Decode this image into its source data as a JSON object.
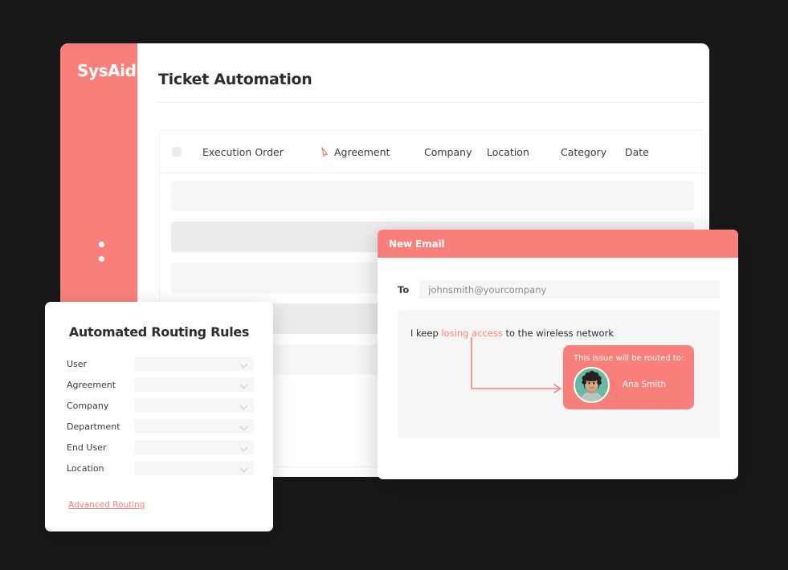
{
  "theme": {
    "accent": "#f9807a",
    "page_background": "#181818",
    "card_background": "#ffffff",
    "row_light": "#f7f7f8",
    "row_dark": "#edebed",
    "field_background": "#f6f6f7",
    "avatar_background": "#6bb9a4"
  },
  "sidebar": {
    "logo": "SysAid.",
    "nav_dots": 2
  },
  "main": {
    "page_title": "Ticket Automation"
  },
  "table": {
    "columns": [
      {
        "key": "select",
        "label": "",
        "icon": "checkbox-icon"
      },
      {
        "key": "execution_order",
        "label": "Execution Order",
        "icon": ""
      },
      {
        "key": "cursor",
        "label": "",
        "icon": "cursor-arrow-icon"
      },
      {
        "key": "agreement",
        "label": "Agreement",
        "icon": ""
      },
      {
        "key": "company",
        "label": "Company",
        "icon": ""
      },
      {
        "key": "location",
        "label": "Location",
        "icon": ""
      },
      {
        "key": "category",
        "label": "Category",
        "icon": ""
      },
      {
        "key": "date",
        "label": "Date",
        "icon": ""
      }
    ],
    "rows": [
      {
        "shade": "light"
      },
      {
        "shade": "dark"
      },
      {
        "shade": "light"
      },
      {
        "shade": "dark"
      },
      {
        "shade": "light"
      }
    ]
  },
  "routing_panel": {
    "title": "Automated Routing Rules",
    "fields": [
      {
        "label": "User",
        "value": ""
      },
      {
        "label": "Agreement",
        "value": ""
      },
      {
        "label": "Company",
        "value": ""
      },
      {
        "label": "Department",
        "value": ""
      },
      {
        "label": "End User",
        "value": ""
      },
      {
        "label": "Location",
        "value": ""
      }
    ],
    "advanced_link": "Advanced Routing"
  },
  "email_panel": {
    "header_title": "New Email",
    "to_label": "To",
    "to_value": "johnsmith@yourcompany",
    "body": {
      "before": "I keep ",
      "highlight": "losing access",
      "after": " to the wireless network"
    },
    "routed_card": {
      "title": "This issue will be routed to:",
      "agent_name": "Ana Smith",
      "avatar_alt": "ana-smith-avatar"
    }
  }
}
